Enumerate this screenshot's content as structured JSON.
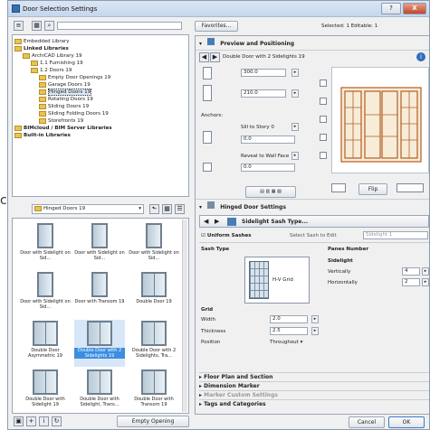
{
  "window": {
    "title": "Door Selection Settings",
    "help": "?",
    "close": "X"
  },
  "library": {
    "tree": [
      {
        "label": "Embedded Library",
        "bold": false,
        "indent": 0
      },
      {
        "label": "Linked Libraries",
        "bold": true,
        "indent": 0
      },
      {
        "label": "ArchiCAD Library 19",
        "bold": false,
        "indent": 1
      },
      {
        "label": "1.1 Furnishing 19",
        "bold": false,
        "indent": 2
      },
      {
        "label": "1.2 Doors 19",
        "bold": false,
        "indent": 2
      },
      {
        "label": "Empty Door Openings 19",
        "bold": false,
        "indent": 3
      },
      {
        "label": "Garage Doors 19",
        "bold": false,
        "indent": 3
      },
      {
        "label": "Hinged Doors 19",
        "bold": false,
        "indent": 3,
        "selected": true
      },
      {
        "label": "Rotating Doors 19",
        "bold": false,
        "indent": 3
      },
      {
        "label": "Sliding Doors 19",
        "bold": false,
        "indent": 3
      },
      {
        "label": "Sliding Folding Doors 19",
        "bold": false,
        "indent": 3
      },
      {
        "label": "Storefronts 19",
        "bold": false,
        "indent": 3
      },
      {
        "label": "BIMcloud / BIM Server Libraries",
        "bold": true,
        "indent": 0
      },
      {
        "label": "Built-in Libraries",
        "bold": true,
        "indent": 0
      }
    ],
    "folder_select": "Hinged Doors 19",
    "thumbs": [
      "Door with Sidelight on Sid...",
      "Door with Sidelight on Sid...",
      "Door with Sidelight on Sid...",
      "Door with Sidelight on Sid...",
      "Door with Transom 19",
      "Double Door 19",
      "Double Door Asymmetric 19",
      "Double Door with 2 Sidelights 19",
      "Double Door with 2 Sidelights, Tra...",
      "Double Door with Sidelight 19",
      "Double Door with Sidelight, Trans...",
      "Double Door with Transom 19"
    ],
    "empty_opening": "Empty Opening"
  },
  "right": {
    "favorites": "Favorites...",
    "selected_info": "Selected: 1 Editable: 1",
    "preview_section": "Preview and Positioning",
    "object_name": "Double Door with 2 Sidelights 19",
    "width": "300.0",
    "height": "210.0",
    "anchors_label": "Anchors:",
    "sill_label": "Sill to Story 0",
    "sill_value": "0.0",
    "reveal_label": "Reveal to Wall Face",
    "reveal_value": "0.0",
    "flip": "Flip",
    "settings_section": "Hinged Door Settings",
    "sash_type_btn": "Sidelight Sash Type...",
    "uniform_sashes": "Uniform Sashes",
    "select_sash_label": "Select Sash to Edit",
    "select_sash_value": "Sidelight 1",
    "sash_type_label": "Sash Type",
    "panes_number": "Panes Number",
    "sidelight": "Sidelight",
    "vertically": "Vertically",
    "vertically_value": "4",
    "horizontally": "Horizontally",
    "horizontally_value": "2",
    "sash_preview_label": "H-V Grid",
    "grid": "Grid",
    "grid_width_label": "Width",
    "grid_width": "2.0",
    "grid_thickness_label": "Thickness",
    "grid_thickness": "2.5",
    "grid_position_label": "Position",
    "grid_position": "Throughout",
    "sections": [
      "Floor Plan and Section",
      "Dimension Marker",
      "Marker Custom Settings",
      "Tags and Categories"
    ],
    "cancel": "Cancel",
    "ok": "OK"
  },
  "background_text": "ci"
}
